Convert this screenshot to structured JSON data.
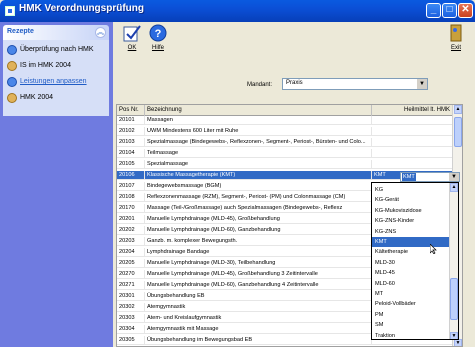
{
  "window": {
    "title": "HMK Verordnungsprüfung"
  },
  "sidebar": {
    "header": "Rezepte",
    "items": [
      {
        "label": "Überprüfung nach HMK",
        "icon": "check-document-icon",
        "link": false
      },
      {
        "label": "IS im HMK 2004",
        "icon": "document-icon",
        "link": false
      },
      {
        "label": "Leistungen anpassen",
        "icon": "edit-icon",
        "link": true
      },
      {
        "label": "HMK 2004",
        "icon": "document-icon",
        "link": false
      }
    ]
  },
  "toolbar": {
    "ok_label": "OK",
    "help_label": "Hilfe",
    "exit_label": "Exit"
  },
  "mandant": {
    "label": "Mandant:",
    "value": "Praxis"
  },
  "grid": {
    "headers": {
      "pos": "Pos Nr.",
      "bez": "Bezeichnung",
      "heil": "Heilmittel lt. HMK"
    },
    "rows": [
      {
        "pos": "20101",
        "bez": "Massagen",
        "heil": ""
      },
      {
        "pos": "20102",
        "bez": "UWM Mindestens 600 Liter mit Ruhe",
        "heil": ""
      },
      {
        "pos": "20103",
        "bez": "Spezialmassage (Bindegewebs-, Reflexzonen-, Segment-, Periost-, Bürsten- und Colo...",
        "heil": ""
      },
      {
        "pos": "20104",
        "bez": "Teilmassage",
        "heil": ""
      },
      {
        "pos": "20105",
        "bez": "Spezialmassage",
        "heil": ""
      },
      {
        "pos": "20106",
        "bez": "Klassische Massagetherapie (KMT)",
        "heil": "KMT"
      },
      {
        "pos": "20107",
        "bez": "Bindegewebsmassage (BGM)",
        "heil": ""
      },
      {
        "pos": "20108",
        "bez": "Reflexzonenmassage (RZM), Segment-, Periost- (PM) und Colonmassage (CM)",
        "heil": ""
      },
      {
        "pos": "20170",
        "bez": "Massage (Teil-/Großmassage) auch Spezialmassagen (Bindegewebs-, Reflexz",
        "heil": ""
      },
      {
        "pos": "20201",
        "bez": "Manuelle Lymphdrainage (MLD-45), Großbehandlung",
        "heil": ""
      },
      {
        "pos": "20202",
        "bez": "Manuelle Lymphdrainage (MLD-60), Ganzbehandlung",
        "heil": ""
      },
      {
        "pos": "20203",
        "bez": "Ganzb. m. komplexer Bewegungsth.",
        "heil": ""
      },
      {
        "pos": "20204",
        "bez": "Lymphdrainage Bandage",
        "heil": ""
      },
      {
        "pos": "20205",
        "bez": "Manuelle Lymphdrainage (MLD-30), Teilbehandlung",
        "heil": ""
      },
      {
        "pos": "20270",
        "bez": "Manuelle Lymphdrainage (MLD-45), Großbehandlung 3 Zeitintervalle",
        "heil": ""
      },
      {
        "pos": "20271",
        "bez": "Manuelle Lymphdrainage (MLD-60), Ganzbehandlung 4 Zeitintervalle",
        "heil": ""
      },
      {
        "pos": "20301",
        "bez": "Übungsbehandlung EB",
        "heil": ""
      },
      {
        "pos": "20302",
        "bez": "Atemgymnastik",
        "heil": ""
      },
      {
        "pos": "20303",
        "bez": "Atem- und Kreislaufgymnastik",
        "heil": ""
      },
      {
        "pos": "20304",
        "bez": "Atemgymnastik mit Massage",
        "heil": ""
      },
      {
        "pos": "20305",
        "bez": "Übungsbehandlung im Bewegungsbad EB",
        "heil": ""
      }
    ]
  },
  "combo": {
    "value": "KMT"
  },
  "dropdown_options": [
    "KG",
    "KG-Gerät",
    "KG-Mukoviszidose",
    "KG-ZNS-Kinder",
    "KG-ZNS",
    "KMT",
    "Kältetherapie",
    "MLD-30",
    "MLD-45",
    "MLD-60",
    "MT",
    "Peloid-Vollbäder",
    "PM",
    "SM",
    "Traktion"
  ]
}
